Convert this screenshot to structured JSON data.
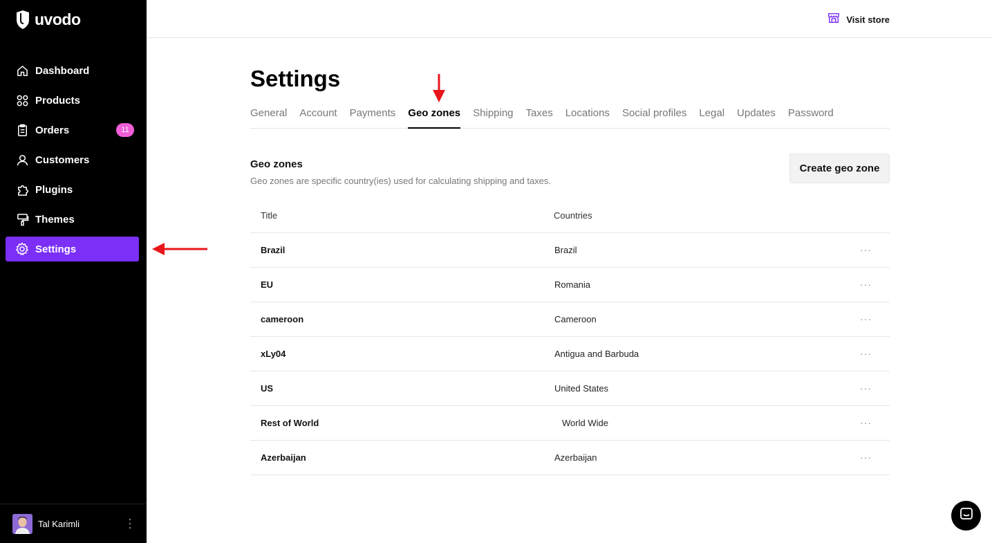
{
  "app": {
    "name": "uvodo"
  },
  "sidebar": {
    "items": [
      {
        "label": "Dashboard",
        "icon": "home-icon"
      },
      {
        "label": "Products",
        "icon": "grid-circles-icon"
      },
      {
        "label": "Orders",
        "icon": "clipboard-icon",
        "badge": "11"
      },
      {
        "label": "Customers",
        "icon": "user-icon"
      },
      {
        "label": "Plugins",
        "icon": "puzzle-icon"
      },
      {
        "label": "Themes",
        "icon": "paint-roller-icon"
      },
      {
        "label": "Settings",
        "icon": "gear-icon",
        "active": true
      }
    ],
    "user": {
      "name": "Tal Karimli"
    }
  },
  "topbar": {
    "visit_store_label": "Visit store"
  },
  "page": {
    "title": "Settings",
    "tabs": [
      {
        "label": "General"
      },
      {
        "label": "Account"
      },
      {
        "label": "Payments"
      },
      {
        "label": "Geo zones",
        "active": true
      },
      {
        "label": "Shipping"
      },
      {
        "label": "Taxes"
      },
      {
        "label": "Locations"
      },
      {
        "label": "Social profiles"
      },
      {
        "label": "Legal"
      },
      {
        "label": "Updates"
      },
      {
        "label": "Password"
      }
    ],
    "section": {
      "title": "Geo zones",
      "description": "Geo zones are specific country(ies) used for calculating shipping and taxes.",
      "create_button": "Create geo zone"
    },
    "table": {
      "headers": {
        "title": "Title",
        "countries": "Countries"
      },
      "rows": [
        {
          "title": "Brazil",
          "countries": "Brazil"
        },
        {
          "title": "EU",
          "countries": "Romania"
        },
        {
          "title": "cameroon",
          "countries": "Cameroon"
        },
        {
          "title": "xLy04",
          "countries": "Antigua and Barbuda"
        },
        {
          "title": "US",
          "countries": "United States"
        },
        {
          "title": "Rest of World",
          "countries": "World Wide"
        },
        {
          "title": "Azerbaijan",
          "countries": "Azerbaijan"
        }
      ],
      "row_menu_glyph": "···"
    }
  },
  "colors": {
    "sidebar_bg": "#000000",
    "accent": "#7b2ff7",
    "badge": "#f25ed8",
    "annotation_arrow": "#e8151b"
  }
}
